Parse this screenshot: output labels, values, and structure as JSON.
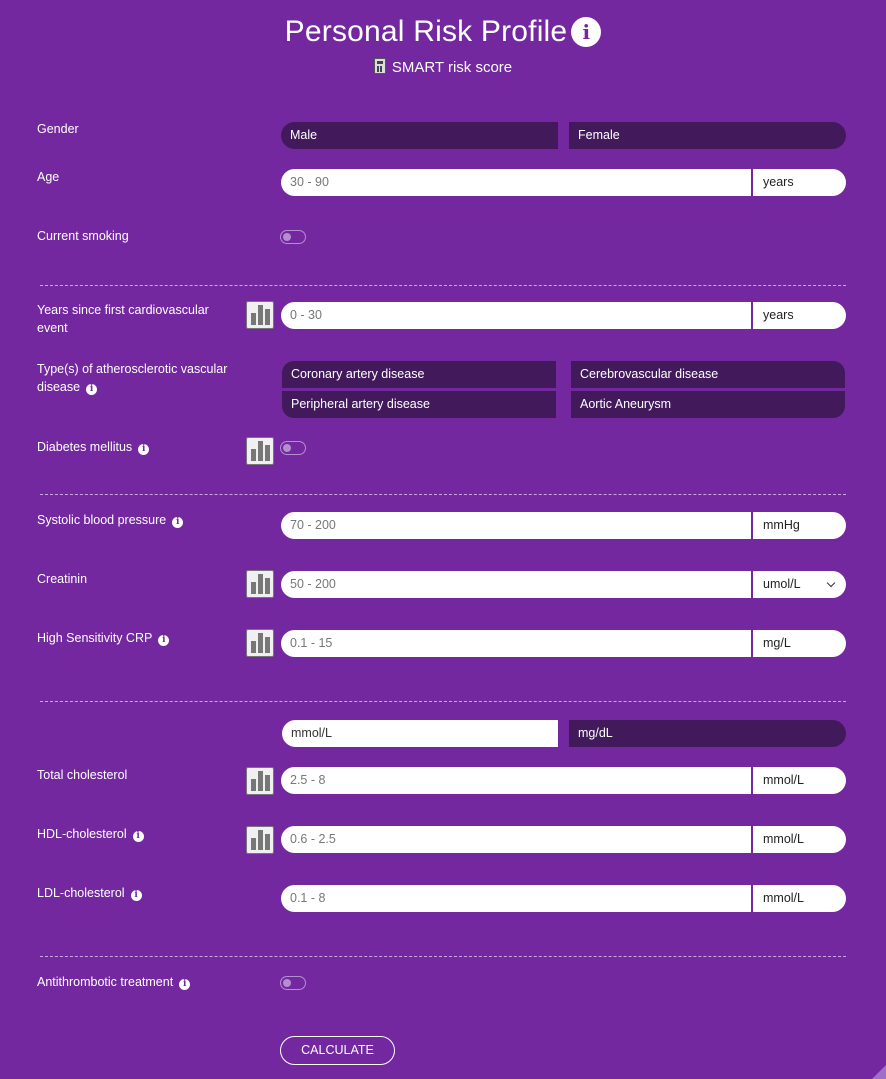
{
  "header": {
    "title": "Personal Risk Profile",
    "subtitle": "SMART risk score"
  },
  "gender": {
    "label": "Gender",
    "options": [
      "Male",
      "Female"
    ]
  },
  "age": {
    "label": "Age",
    "placeholder": "30 - 90",
    "unit": "years"
  },
  "smoking": {
    "label": "Current smoking",
    "on": false
  },
  "years_event": {
    "label": "Years since first cardiovascular event",
    "placeholder": "0 - 30",
    "unit": "years"
  },
  "vascular": {
    "label": "Type(s) of atherosclerotic vascular disease",
    "options": [
      "Coronary artery disease",
      "Cerebrovascular disease",
      "Peripheral artery disease",
      "Aortic Aneurysm"
    ]
  },
  "diabetes": {
    "label": "Diabetes mellitus",
    "on": false
  },
  "sbp": {
    "label": "Systolic blood pressure",
    "placeholder": "70 - 200",
    "unit": "mmHg"
  },
  "creatinin": {
    "label": "Creatinin",
    "placeholder": "50 - 200",
    "unit": "umol/L"
  },
  "crp": {
    "label": "High Sensitivity CRP",
    "placeholder": "0.1 - 15",
    "unit": "mg/L"
  },
  "chol_units": {
    "options": [
      "mmol/L",
      "mg/dL"
    ],
    "selected": "mmol/L"
  },
  "total_chol": {
    "label": "Total cholesterol",
    "placeholder": "2.5 - 8",
    "unit": "mmol/L"
  },
  "hdl": {
    "label": "HDL-cholesterol",
    "placeholder": "0.6 - 2.5",
    "unit": "mmol/L"
  },
  "ldl": {
    "label": "LDL-cholesterol",
    "placeholder": "0.1 - 8",
    "unit": "mmol/L"
  },
  "antithrombotic": {
    "label": "Antithrombotic treatment",
    "on": false
  },
  "calculate_label": "CALCULATE",
  "colors": {
    "background": "#7428a0",
    "segment": "#421a5c",
    "accent": "#ffffff"
  },
  "icons": {
    "info": "info-icon",
    "chart": "bar-chart-icon",
    "calculator": "calculator-icon"
  }
}
